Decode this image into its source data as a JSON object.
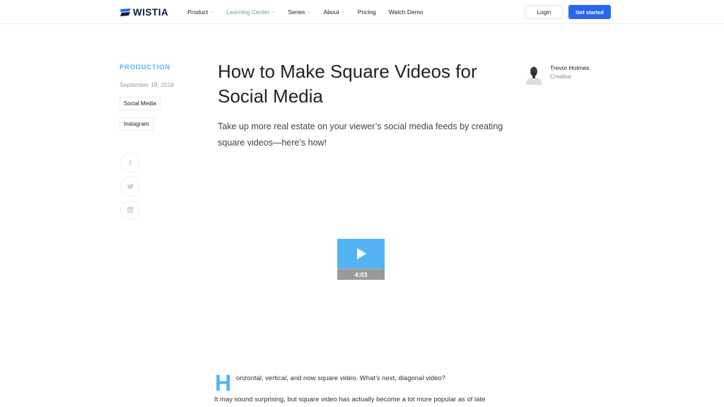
{
  "nav": {
    "logo": "WISTIA",
    "items": [
      {
        "label": "Product",
        "dropdown": true,
        "active": false
      },
      {
        "label": "Learning Center",
        "dropdown": true,
        "active": true
      },
      {
        "label": "Series",
        "dropdown": true,
        "active": false
      },
      {
        "label": "About",
        "dropdown": true,
        "active": false
      },
      {
        "label": "Pricing",
        "dropdown": false,
        "active": false
      },
      {
        "label": "Watch Demo",
        "dropdown": false,
        "active": false
      }
    ],
    "login_label": "Login",
    "cta_label": "Get started"
  },
  "sidebar": {
    "category": "PRODUCTION",
    "date": "September 19, 2018",
    "tags": [
      "Social Media",
      "Instagram"
    ],
    "share_icons": [
      "facebook-icon",
      "twitter-icon",
      "linkedin-icon"
    ]
  },
  "article": {
    "title": "How to Make Square Videos for Social Media",
    "subtitle": "Take up more real estate on your viewer’s social media feeds by creating square videos—here’s how!",
    "author": {
      "name": "Trevor Holmes",
      "role": "Creative"
    },
    "video": {
      "duration": "4:03"
    },
    "dropcap": "H",
    "body_line1": "orizontal, vertical, and now square video. What’s next, diagonal video?",
    "body_line2": "It may sound surprising, but square video has actually become a lot more popular as of late"
  },
  "colors": {
    "accent_blue": "#54b3f5",
    "cta_blue": "#2a66ec",
    "active_nav": "#4fb28a"
  }
}
